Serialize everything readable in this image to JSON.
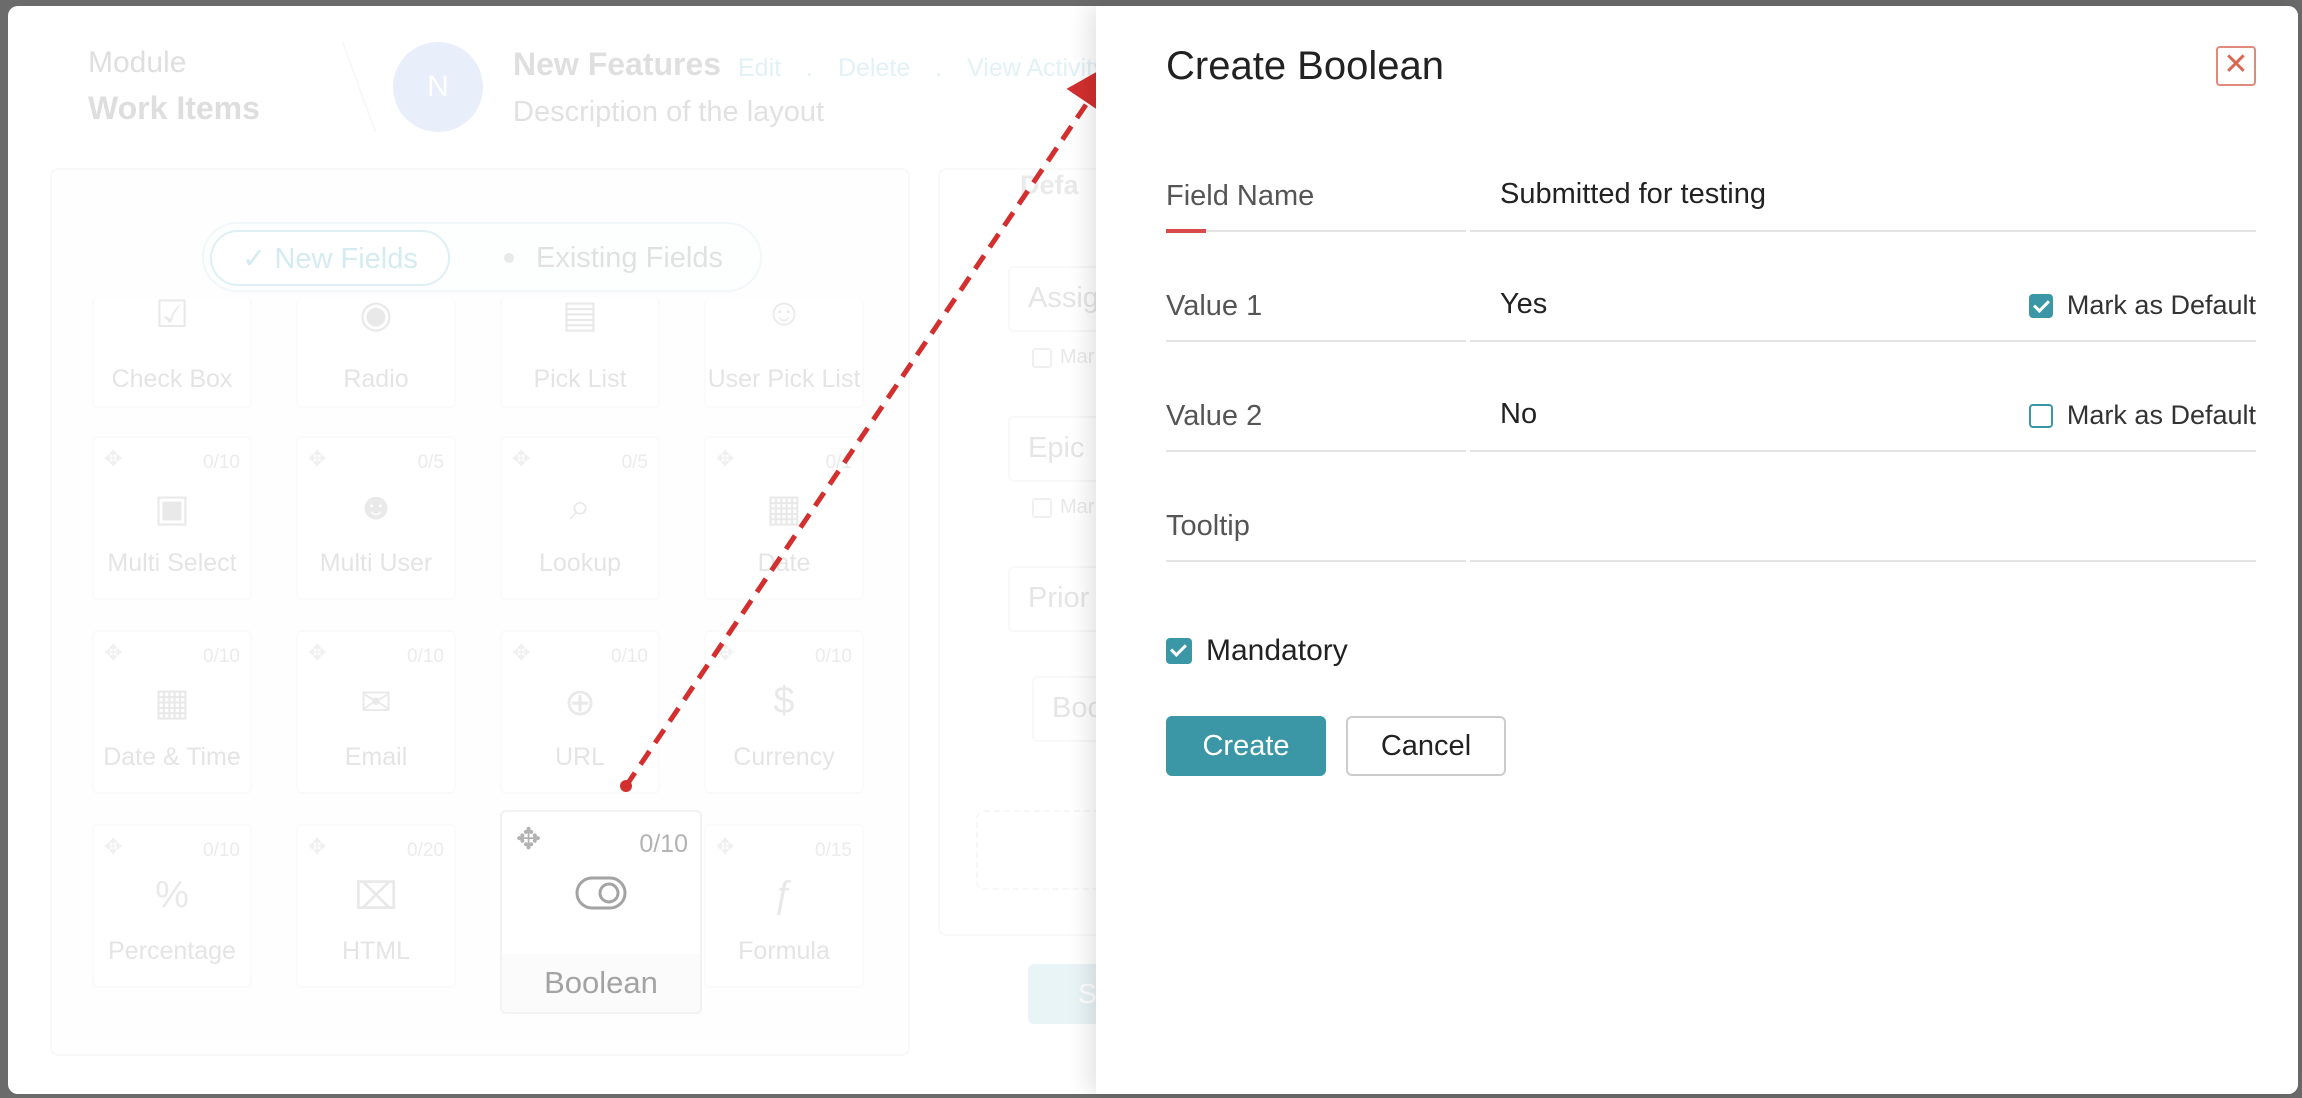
{
  "background": {
    "module_label": "Module",
    "module_name": "Work Items",
    "avatar_initial": "N",
    "layout_title": "New Features",
    "layout_actions": [
      "Edit",
      ".",
      "Delete",
      ".",
      "View Activity"
    ],
    "layout_description": "Description of the layout",
    "toggle": {
      "new_fields": "✓ New Fields",
      "existing_fields": "Existing Fields"
    },
    "field_tiles": [
      {
        "label": "Check Box",
        "count": "",
        "icon": "checkbox-icon"
      },
      {
        "label": "Radio",
        "count": "",
        "icon": "radio-icon"
      },
      {
        "label": "Pick List",
        "count": "",
        "icon": "pick-list-icon"
      },
      {
        "label": "User Pick List",
        "count": "",
        "icon": "user-pick-list-icon"
      },
      {
        "label": "Multi Select",
        "count": "0/10",
        "icon": "multi-select-icon"
      },
      {
        "label": "Multi User",
        "count": "0/5",
        "icon": "multi-user-icon"
      },
      {
        "label": "Lookup",
        "count": "0/5",
        "icon": "lookup-icon"
      },
      {
        "label": "Date",
        "count": "0/1",
        "icon": "date-icon"
      },
      {
        "label": "Date & Time",
        "count": "0/10",
        "icon": "date-time-icon"
      },
      {
        "label": "Email",
        "count": "0/10",
        "icon": "email-icon"
      },
      {
        "label": "URL",
        "count": "0/10",
        "icon": "url-icon"
      },
      {
        "label": "Currency",
        "count": "0/10",
        "icon": "currency-icon"
      },
      {
        "label": "Percentage",
        "count": "0/10",
        "icon": "percentage-icon"
      },
      {
        "label": "HTML",
        "count": "0/20",
        "icon": "html-icon"
      },
      {
        "label": "Boolean",
        "count": "0/10",
        "icon": "boolean-toggle-icon"
      },
      {
        "label": "Formula",
        "count": "0/15",
        "icon": "formula-icon"
      }
    ],
    "preview": {
      "tab_label": "Defa",
      "fields": [
        "Assig",
        "Epic",
        "Prior",
        "Boo"
      ],
      "mark_label": "Mar",
      "save_label": "S"
    }
  },
  "modal": {
    "title": "Create Boolean",
    "close_label": "✕",
    "rows": [
      {
        "label": "Field Name",
        "value": "Submitted for testing",
        "mark_default": null
      },
      {
        "label": "Value 1",
        "value": "Yes",
        "mark_default": {
          "label": "Mark as Default",
          "checked": true
        }
      },
      {
        "label": "Value 2",
        "value": "No",
        "mark_default": {
          "label": "Mark as Default",
          "checked": false
        }
      },
      {
        "label": "Tooltip",
        "value": "",
        "mark_default": null
      }
    ],
    "mandatory": {
      "label": "Mandatory",
      "checked": true
    },
    "create_label": "Create",
    "cancel_label": "Cancel"
  },
  "colors": {
    "accent": "#3b97a6",
    "close": "#d9674f",
    "focus": "#d94b4b",
    "arrow": "#d32f2f"
  }
}
